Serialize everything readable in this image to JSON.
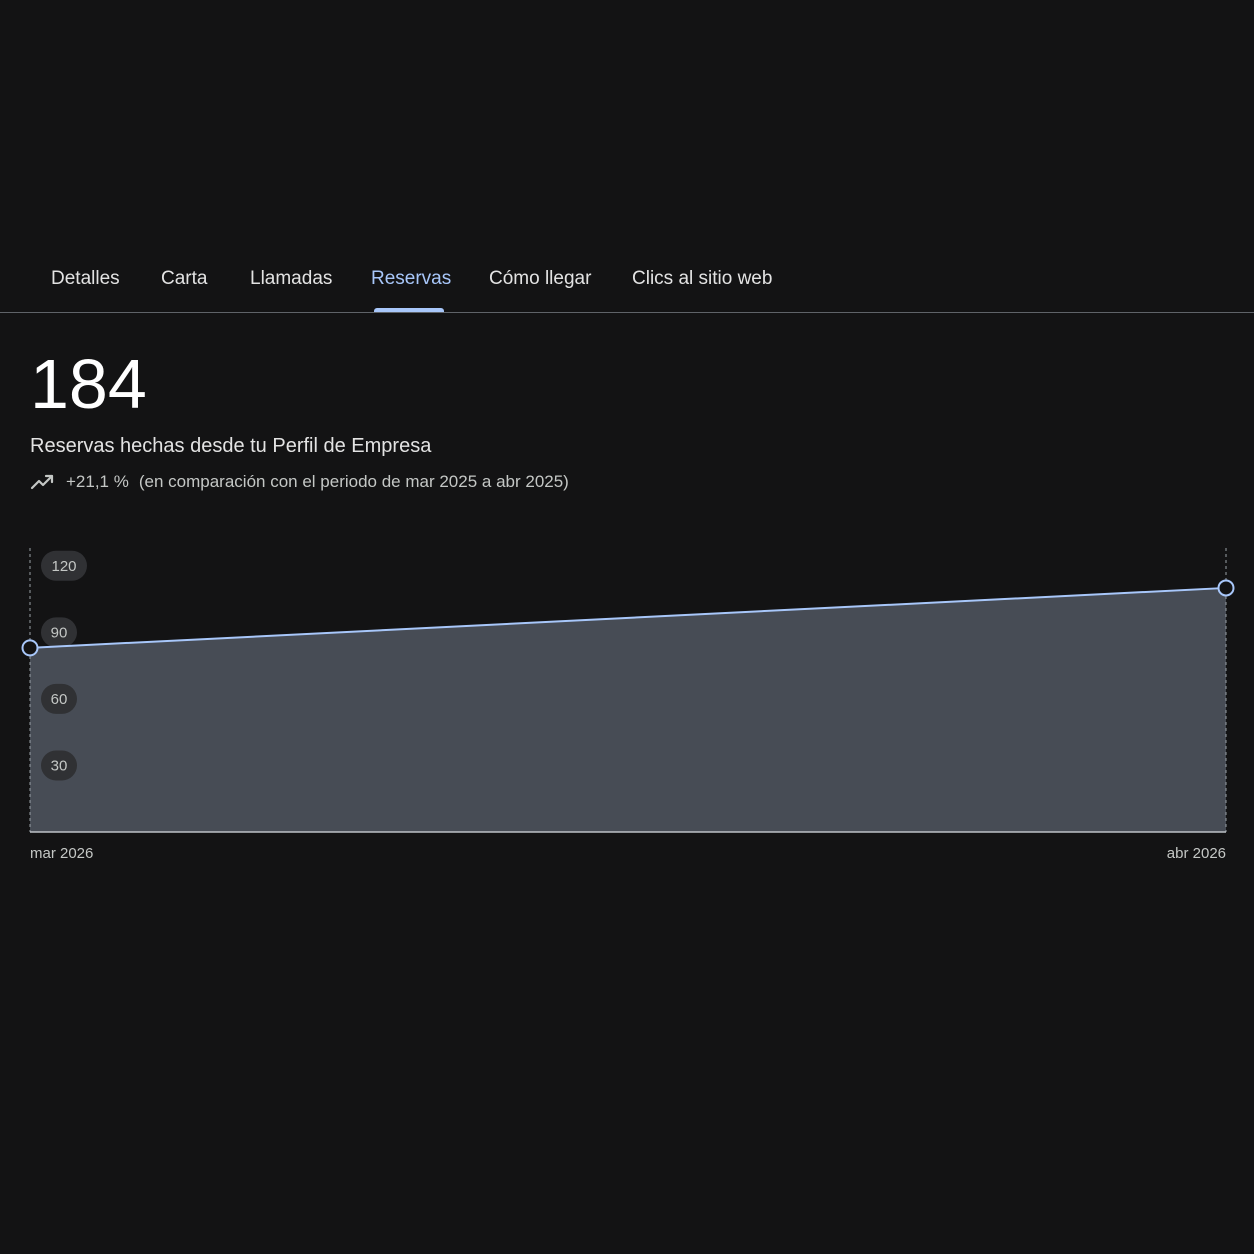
{
  "tabs": [
    {
      "label": "Detalles",
      "active": false
    },
    {
      "label": "Carta",
      "active": false
    },
    {
      "label": "Llamadas",
      "active": false
    },
    {
      "label": "Reservas",
      "active": true
    },
    {
      "label": "Cómo llegar",
      "active": false
    },
    {
      "label": "Clics al sitio web",
      "active": false
    }
  ],
  "summary": {
    "total": "184",
    "description": "Reservas hechas desde tu Perfil de Empresa",
    "change": "+21,1 %",
    "comparison": "(en comparación con el periodo de mar 2025 a abr 2025)",
    "trend_icon": "trending-up-icon"
  },
  "colors": {
    "accent": "#a8c7fa",
    "background": "#131314",
    "area_fill": "#4a4f58"
  },
  "chart_data": {
    "type": "area",
    "x": [
      "mar 2026",
      "abr 2026"
    ],
    "series": [
      {
        "values": [
          83,
          110
        ]
      }
    ],
    "ylim": [
      0,
      128
    ],
    "yticks": [
      30,
      60,
      90,
      120
    ],
    "grid": false
  }
}
